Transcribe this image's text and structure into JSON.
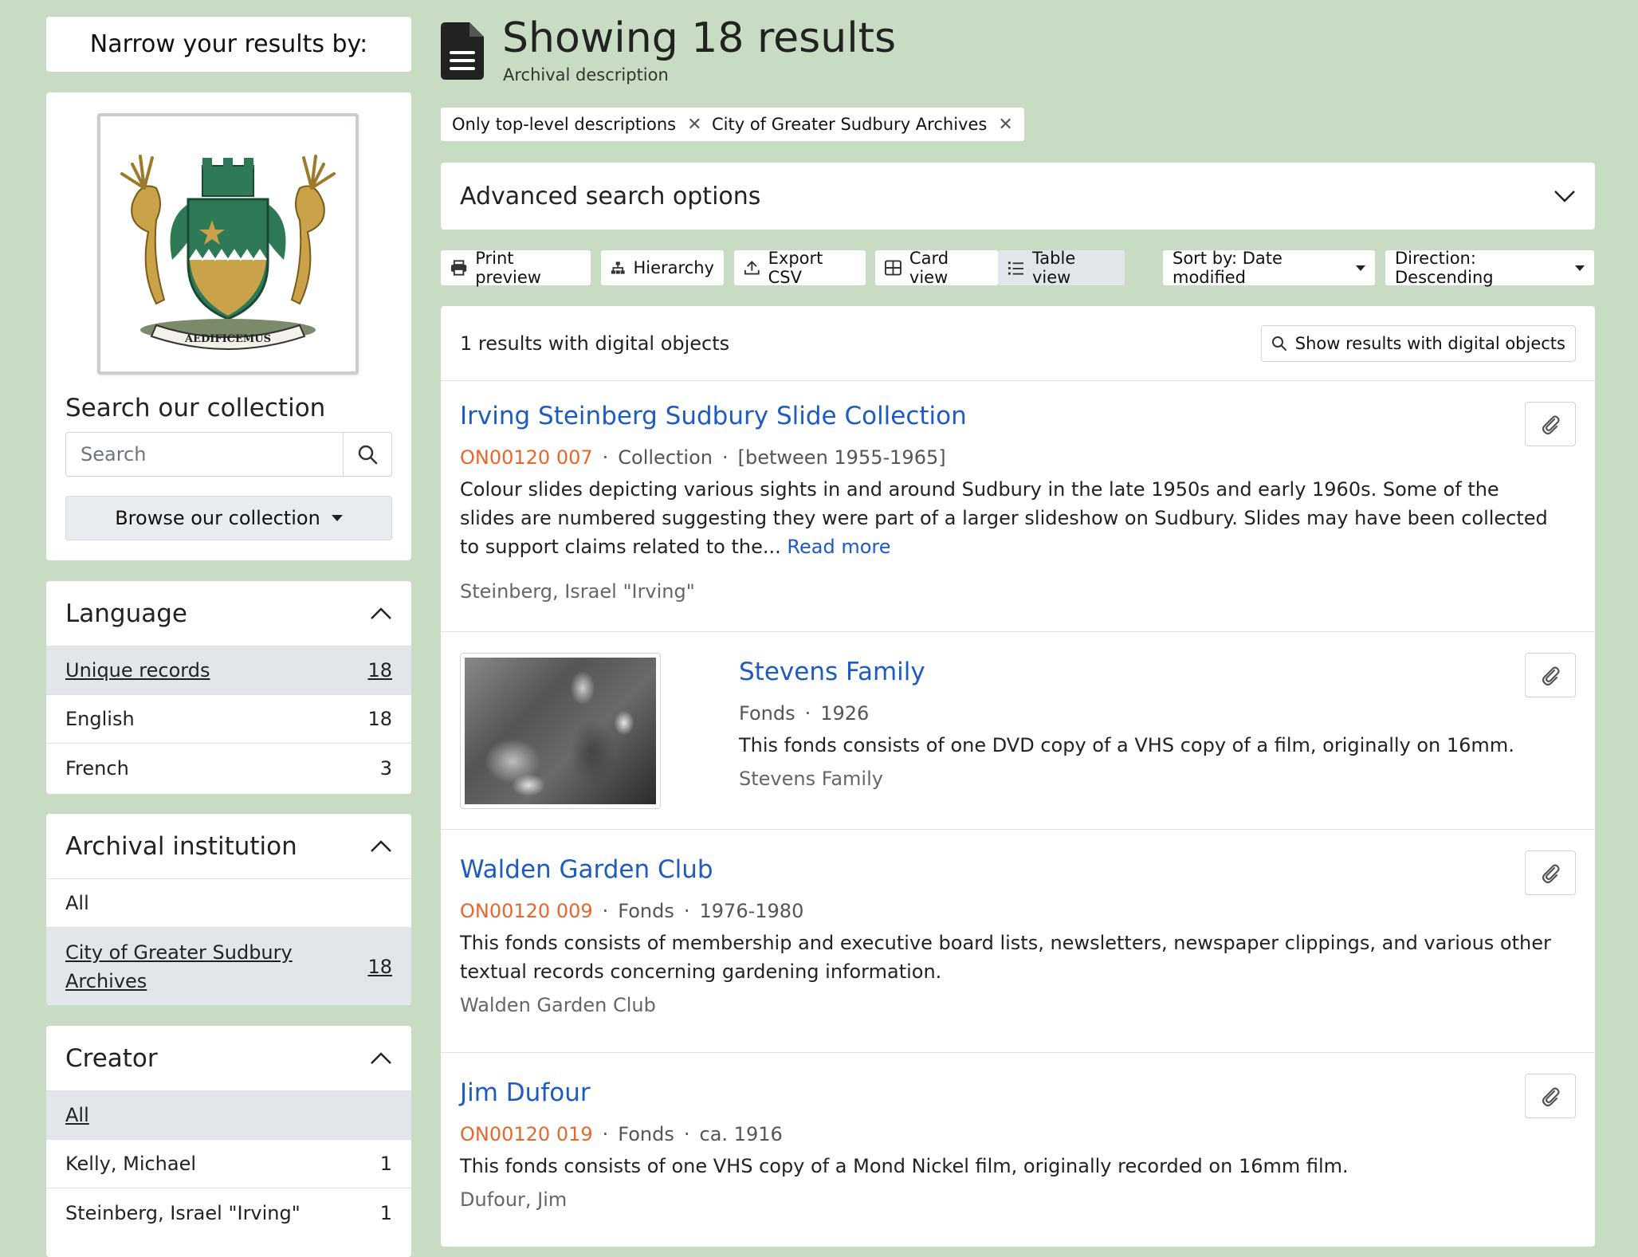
{
  "sidebar": {
    "narrow_label": "Narrow your results by:",
    "search_title": "Search our collection",
    "search_placeholder": "Search",
    "browse_label": "Browse our collection",
    "logo_motto": "AEDIFICEMUS",
    "facets": {
      "language": {
        "title": "Language",
        "rows": [
          {
            "label": "Unique records",
            "count": "18"
          },
          {
            "label": "English",
            "count": "18"
          },
          {
            "label": "French",
            "count": "3"
          }
        ]
      },
      "institution": {
        "title": "Archival institution",
        "rows": [
          {
            "label": "All",
            "count": ""
          },
          {
            "label": "City of Greater Sudbury Archives",
            "count": "18"
          }
        ]
      },
      "creator": {
        "title": "Creator",
        "rows": [
          {
            "label": "All",
            "count": ""
          },
          {
            "label": "Kelly, Michael",
            "count": "1"
          },
          {
            "label": "Steinberg, Israel \"Irving\"",
            "count": "1"
          }
        ]
      }
    }
  },
  "header": {
    "title": "Showing 18 results",
    "subtitle": "Archival description"
  },
  "filters": [
    {
      "label": "Only top-level descriptions"
    },
    {
      "label": "City of Greater Sudbury Archives"
    }
  ],
  "advanced_label": "Advanced search options",
  "toolbar": {
    "print_label": "Print preview",
    "hierarchy_label": "Hierarchy",
    "export_label": "Export CSV",
    "card_label": "Card view",
    "table_label": "Table view",
    "sort_label": "Sort by: Date modified",
    "direction_label": "Direction: Descending"
  },
  "digital": {
    "summary": "1 results with digital objects",
    "button_label": "Show results with digital objects"
  },
  "results": [
    {
      "title": "Irving Steinberg Sudbury Slide Collection",
      "ref": "ON00120 007",
      "level": "Collection",
      "date": "[between 1955-1965]",
      "description": "Colour slides depicting various sights in and around Sudbury in the late 1950s and early 1960s. Some of the slides are numbered suggesting they were part of a larger slideshow on Sudbury. Slides may have been collected to support claims related to the...",
      "read_more": "Read more",
      "creator": "Steinberg, Israel \"Irving\""
    },
    {
      "title": "Stevens Family",
      "ref": "",
      "level": "Fonds",
      "date": "1926",
      "description": "This fonds consists of one DVD copy of a VHS copy of a film, originally on 16mm.",
      "creator": "Stevens Family"
    },
    {
      "title": "Walden Garden Club",
      "ref": "ON00120 009",
      "level": "Fonds",
      "date": "1976-1980",
      "description": "This fonds consists of membership and executive board lists, newsletters, newspaper clippings, and various other textual records concerning gardening information.",
      "creator": "Walden Garden Club"
    },
    {
      "title": "Jim Dufour",
      "ref": "ON00120 019",
      "level": "Fonds",
      "date": "ca. 1916",
      "description": "This fonds consists of one VHS copy of a Mond Nickel film, originally recorded on 16mm film.",
      "creator": "Dufour, Jim"
    }
  ],
  "colors": {
    "background": "#c7dcc2",
    "link": "#1d5bc0",
    "reference": "#e8662a"
  }
}
